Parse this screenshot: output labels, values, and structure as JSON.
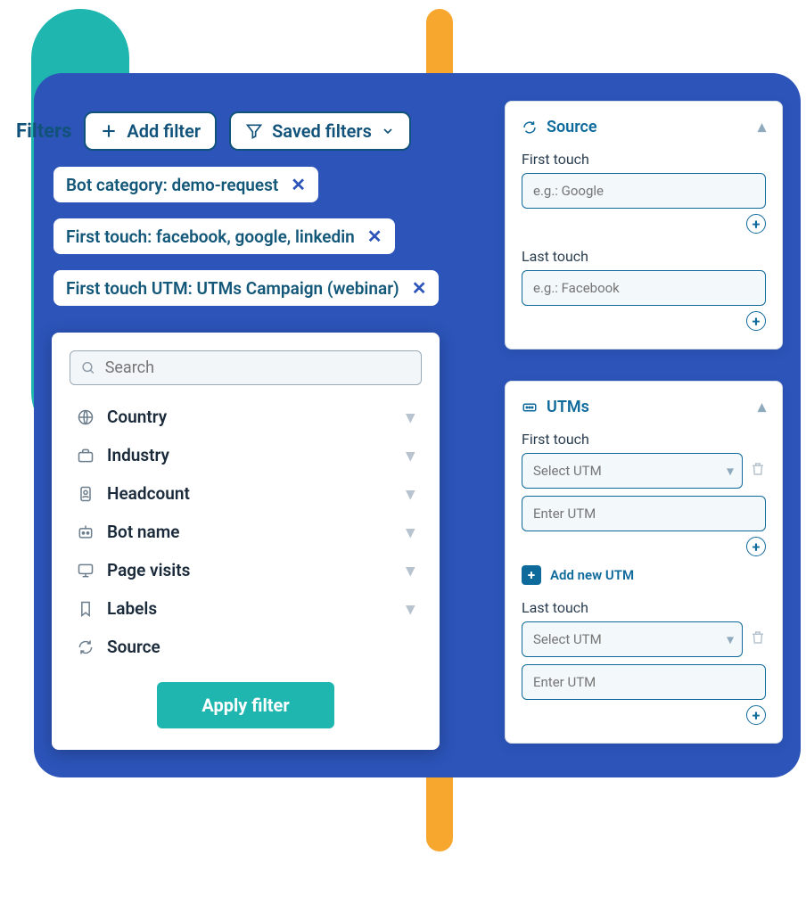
{
  "filters": {
    "label": "Filters",
    "add_btn": "Add filter",
    "saved_btn": "Saved filters",
    "chips": [
      "Bot category: demo-request",
      "First touch: facebook, google, linkedin",
      "First touch UTM: UTMs Campaign (webinar)"
    ]
  },
  "search": {
    "placeholder": "Search"
  },
  "filter_items": [
    {
      "label": "Country",
      "icon": "globe"
    },
    {
      "label": "Industry",
      "icon": "briefcase"
    },
    {
      "label": "Headcount",
      "icon": "badge"
    },
    {
      "label": "Bot name",
      "icon": "bot"
    },
    {
      "label": "Page visits",
      "icon": "monitor"
    },
    {
      "label": "Labels",
      "icon": "bookmark"
    },
    {
      "label": "Source",
      "icon": "refresh"
    }
  ],
  "apply_btn": "Apply filter",
  "source_card": {
    "title": "Source",
    "first_label": "First touch",
    "first_placeholder": "e.g.: Google",
    "last_label": "Last touch",
    "last_placeholder": "e.g.: Facebook"
  },
  "utm_card": {
    "title": "UTMs",
    "first_label": "First touch",
    "select_placeholder": "Select UTM",
    "enter_placeholder": "Enter UTM",
    "add_new": "Add new UTM",
    "last_label": "Last touch"
  }
}
